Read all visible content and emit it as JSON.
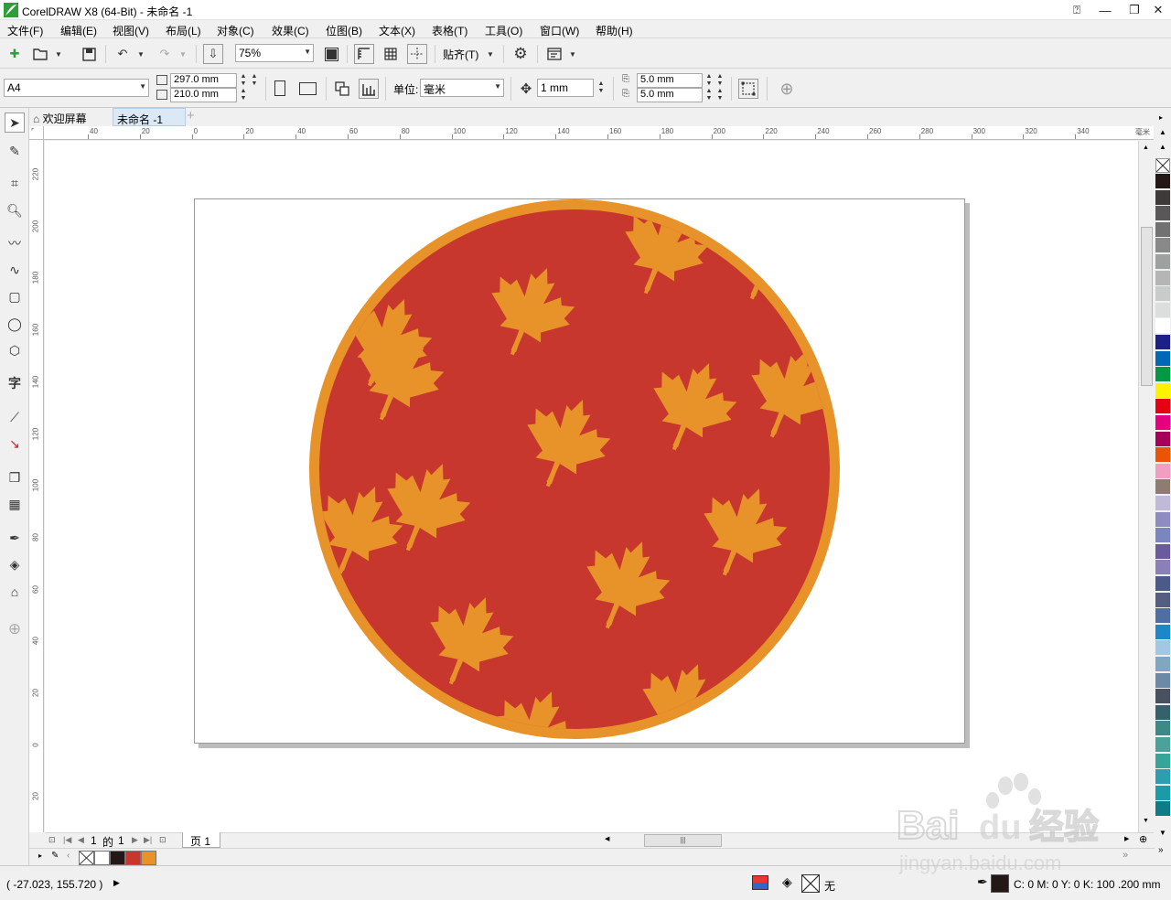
{
  "window": {
    "title": "CorelDRAW X8 (64-Bit) - 未命名 -1",
    "min_icon": "minimize-icon",
    "max_icon": "restore-icon",
    "close_icon": "close-icon"
  },
  "menu": [
    "文件(F)",
    "编辑(E)",
    "视图(V)",
    "布局(L)",
    "对象(C)",
    "效果(C)",
    "位图(B)",
    "文本(X)",
    "表格(T)",
    "工具(O)",
    "窗口(W)",
    "帮助(H)"
  ],
  "toolbar": {
    "zoom_value": "75%",
    "snap_label": "贴齐(T)"
  },
  "propbar": {
    "page_size": "A4",
    "width": "297.0 mm",
    "height": "210.0 mm",
    "units_label": "单位:",
    "units_value": "毫米",
    "nudge": "1 mm",
    "dup_x": "5.0 mm",
    "dup_y": "5.0 mm"
  },
  "tabs": {
    "welcome": "欢迎屏幕",
    "document": "未命名 -1"
  },
  "rulers": {
    "h_ticks": [
      "40",
      "20",
      "0",
      "20",
      "40",
      "60",
      "80",
      "100",
      "120",
      "140",
      "160",
      "180",
      "200",
      "220",
      "240",
      "260",
      "280",
      "300",
      "320",
      "340"
    ],
    "v_ticks": [
      "220",
      "200",
      "180",
      "160",
      "140",
      "120",
      "100",
      "80",
      "60",
      "40",
      "20",
      "0",
      "20"
    ],
    "unit_label": "毫米"
  },
  "page_nav": {
    "current": "1",
    "of_label": "的",
    "total": "1",
    "page_tab": "页 1"
  },
  "doc_palette": [
    "none",
    "#ffffff",
    "#231815",
    "#c8372d",
    "#e8922a"
  ],
  "palette": [
    "#231815",
    "#3e3a39",
    "#595757",
    "#727171",
    "#898989",
    "#9fa0a0",
    "#b5b5b6",
    "#c9caca",
    "#dcdddd",
    "#ffffff",
    "#1d2088",
    "#0068b7",
    "#009944",
    "#fff100",
    "#e60012",
    "#e4007f",
    "#a6005b",
    "#ea5404",
    "#f19ec2",
    "#8f7b6f",
    "#c0b9d8",
    "#8d8cc2",
    "#7b86be",
    "#6a5b9e",
    "#8b7fb8",
    "#4b5a8a",
    "#565d82",
    "#4f6fa2",
    "#1d88c9",
    "#a0c8e5",
    "#7fa7c0",
    "#6c8aa7",
    "#49505f",
    "#34626b",
    "#3b8a86",
    "#4aa39a",
    "#35a59a",
    "#2b9fb0",
    "#1b9ba7",
    "#0d7b88"
  ],
  "artwork": {
    "circle_fill": "#c8372d",
    "circle_stroke": "#e8922a",
    "leaf_color": "#e8922a"
  },
  "status": {
    "coords": "( -27.023, 155.720 )",
    "fill_none": "无",
    "outline": "C: 0 M: 0 Y: 0 K: 100  .200 mm"
  },
  "watermark": {
    "brand": "Bai",
    "brand2": "du",
    "cn": "经验",
    "url": "jingyan.baidu.com"
  }
}
